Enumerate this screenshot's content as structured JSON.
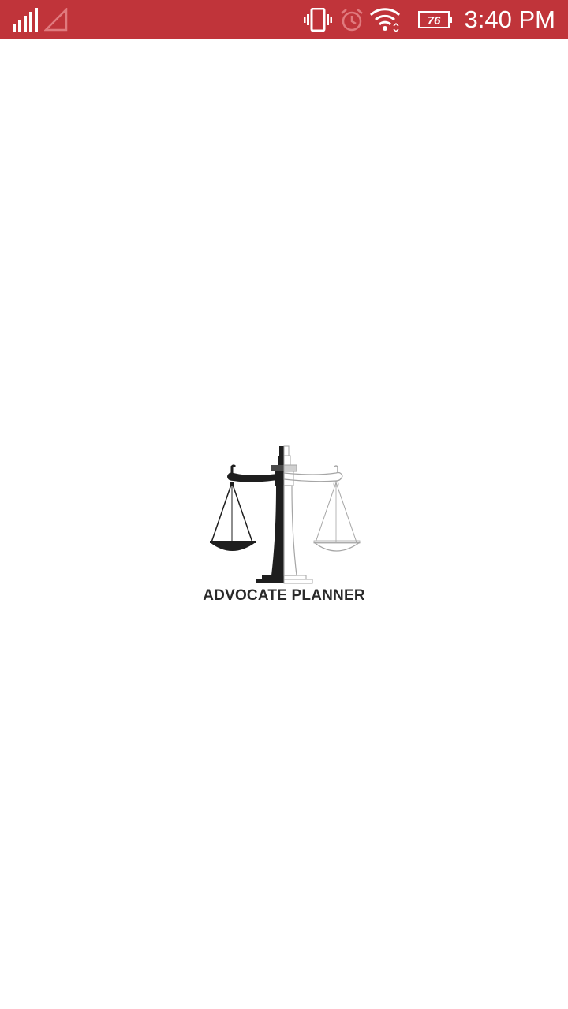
{
  "status_bar": {
    "background": "#c0343a",
    "time": "3:40 PM",
    "battery_level": "76",
    "icons": [
      "signal-icon",
      "no-sim-signal-icon",
      "vibrate-icon",
      "alarm-icon",
      "wifi-icon",
      "battery-icon"
    ]
  },
  "splash": {
    "app_name": "ADVOCATE PLANNER",
    "logo_icon": "scales-of-justice-icon"
  }
}
